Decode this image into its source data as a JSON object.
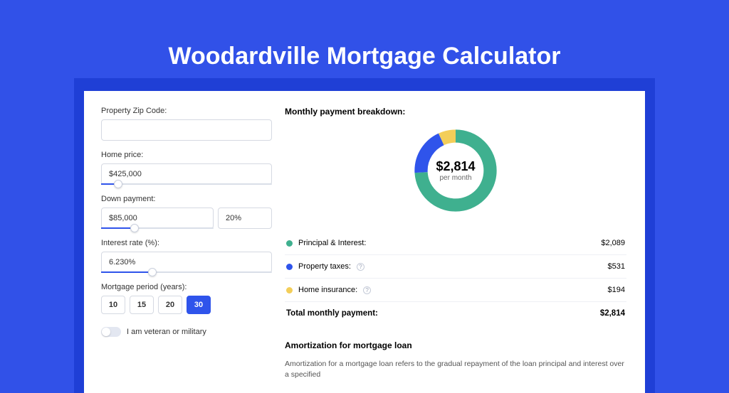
{
  "title": "Woodardville Mortgage Calculator",
  "form": {
    "zip": {
      "label": "Property Zip Code:",
      "value": ""
    },
    "price": {
      "label": "Home price:",
      "value": "$425,000",
      "slider_pct": 10
    },
    "down": {
      "label": "Down payment:",
      "amount": "$85,000",
      "pct": "20%",
      "slider_pct": 20
    },
    "rate": {
      "label": "Interest rate (%):",
      "value": "6.230%",
      "slider_pct": 30
    },
    "period": {
      "label": "Mortgage period (years):",
      "options": [
        "10",
        "15",
        "20",
        "30"
      ],
      "selected": "30"
    },
    "veteran": {
      "label": "I am veteran or military",
      "on": false
    }
  },
  "breakdown": {
    "heading": "Monthly payment breakdown:",
    "center_amount": "$2,814",
    "center_sub": "per month",
    "rows": [
      {
        "label": "Principal & Interest:",
        "value": "$2,089",
        "color": "#3fb08f",
        "info": false
      },
      {
        "label": "Property taxes:",
        "value": "$531",
        "color": "#2f54eb",
        "info": true
      },
      {
        "label": "Home insurance:",
        "value": "$194",
        "color": "#f3ce59",
        "info": true
      }
    ],
    "total_label": "Total monthly payment:",
    "total_value": "$2,814"
  },
  "chart_data": {
    "type": "pie",
    "title": "Monthly payment breakdown",
    "categories": [
      "Principal & Interest",
      "Property taxes",
      "Home insurance"
    ],
    "values": [
      2089,
      531,
      194
    ],
    "colors": [
      "#3fb08f",
      "#2f54eb",
      "#f3ce59"
    ],
    "center_label": "$2,814 per month"
  },
  "amortization": {
    "heading": "Amortization for mortgage loan",
    "body": "Amortization for a mortgage loan refers to the gradual repayment of the loan principal and interest over a specified"
  }
}
